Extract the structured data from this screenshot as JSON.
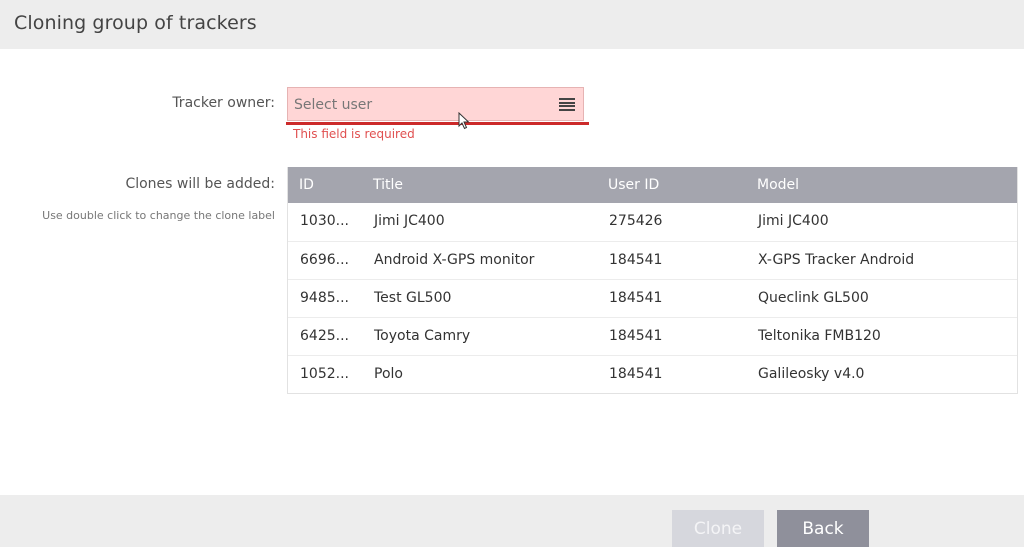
{
  "dialog": {
    "title": "Cloning group of trackers"
  },
  "owner": {
    "label": "Tracker owner:",
    "placeholder": "Select user",
    "error": "This field is required"
  },
  "clones": {
    "label": "Clones will be added:",
    "hint": "Use double click to change the clone label",
    "columns": {
      "id": "ID",
      "title": "Title",
      "user_id": "User ID",
      "model": "Model"
    },
    "rows": [
      {
        "id": "1030...",
        "title": "Jimi JC400",
        "user_id": "275426",
        "model": "Jimi JC400"
      },
      {
        "id": "6696...",
        "title": "Android X-GPS monitor",
        "user_id": "184541",
        "model": "X-GPS Tracker Android"
      },
      {
        "id": "9485...",
        "title": "Test GL500",
        "user_id": "184541",
        "model": "Queclink GL500"
      },
      {
        "id": "6425...",
        "title": "Toyota Camry",
        "user_id": "184541",
        "model": "Teltonika FMB120"
      },
      {
        "id": "1052...",
        "title": "Polo",
        "user_id": "184541",
        "model": "Galileosky v4.0"
      }
    ]
  },
  "footer": {
    "clone_label": "Clone",
    "back_label": "Back"
  },
  "colors": {
    "header_bg": "#ededed",
    "table_header_bg": "#a4a5ae",
    "error_bg": "#ffd6d6",
    "error_line": "#cc2a2a",
    "error_text": "#e05050",
    "button_active": "#8f909b",
    "button_disabled": "#d6d7dd"
  }
}
